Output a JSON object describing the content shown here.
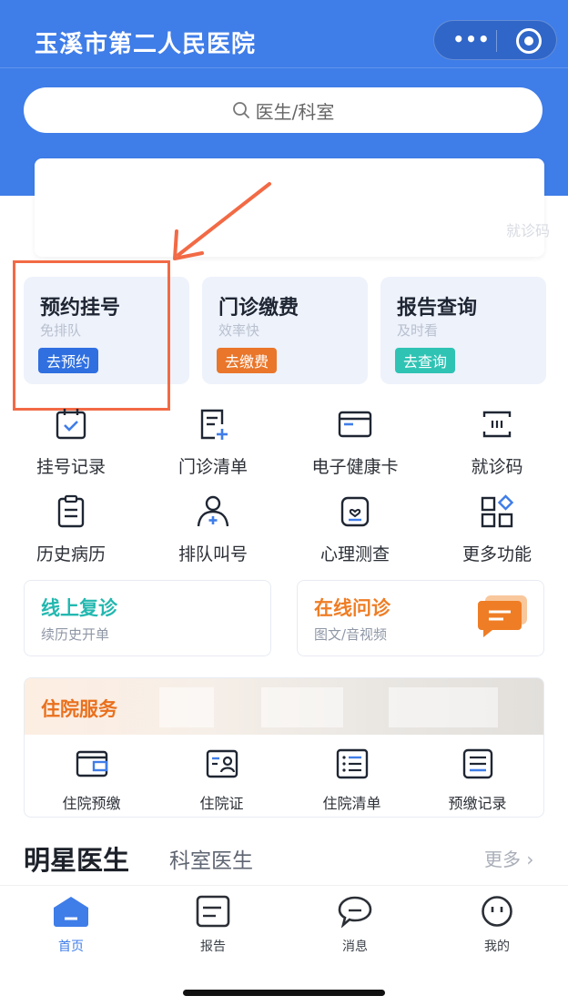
{
  "header": {
    "title": "玉溪市第二人民医院",
    "capsule_more": "•••",
    "accent": "#3f7de8"
  },
  "search": {
    "placeholder": "医生/科室"
  },
  "banner": {
    "partial_text": "就诊码"
  },
  "quick_cards": [
    {
      "title": "预约挂号",
      "subtitle": "免排队",
      "button": "去预约",
      "color": "#2f6fe0"
    },
    {
      "title": "门诊缴费",
      "subtitle": "效率快",
      "button": "去缴费",
      "color": "#e9762a"
    },
    {
      "title": "报告查询",
      "subtitle": "及时看",
      "button": "去查询",
      "color": "#2fc3b4"
    }
  ],
  "grid": [
    {
      "label": "挂号记录",
      "icon": "calendar-check-icon"
    },
    {
      "label": "门诊清单",
      "icon": "list-add-icon"
    },
    {
      "label": "电子健康卡",
      "icon": "card-icon"
    },
    {
      "label": "就诊码",
      "icon": "barcode-icon"
    },
    {
      "label": "历史病历",
      "icon": "clipboard-icon"
    },
    {
      "label": "排队叫号",
      "icon": "person-add-icon"
    },
    {
      "label": "心理测查",
      "icon": "heart-note-icon"
    },
    {
      "label": "更多功能",
      "icon": "apps-icon"
    }
  ],
  "consult": [
    {
      "title": "线上复诊",
      "subtitle": "续历史开单",
      "color": "#23b8b0"
    },
    {
      "title": "在线问诊",
      "subtitle": "图文/音视频",
      "color": "#ef7d25"
    }
  ],
  "inpatient": {
    "title": "住院服务",
    "items": [
      {
        "label": "住院预缴",
        "icon": "wallet-icon"
      },
      {
        "label": "住院证",
        "icon": "id-card-icon"
      },
      {
        "label": "住院清单",
        "icon": "list-icon"
      },
      {
        "label": "预缴记录",
        "icon": "record-icon"
      }
    ]
  },
  "section": {
    "star_doctors": "明星医生",
    "dept_doctors": "科室医生",
    "more": "更多"
  },
  "tabbar": [
    {
      "label": "首页",
      "icon": "home-icon",
      "active": true
    },
    {
      "label": "报告",
      "icon": "report-icon",
      "active": false
    },
    {
      "label": "消息",
      "icon": "message-icon",
      "active": false
    },
    {
      "label": "我的",
      "icon": "profile-icon",
      "active": false
    }
  ]
}
